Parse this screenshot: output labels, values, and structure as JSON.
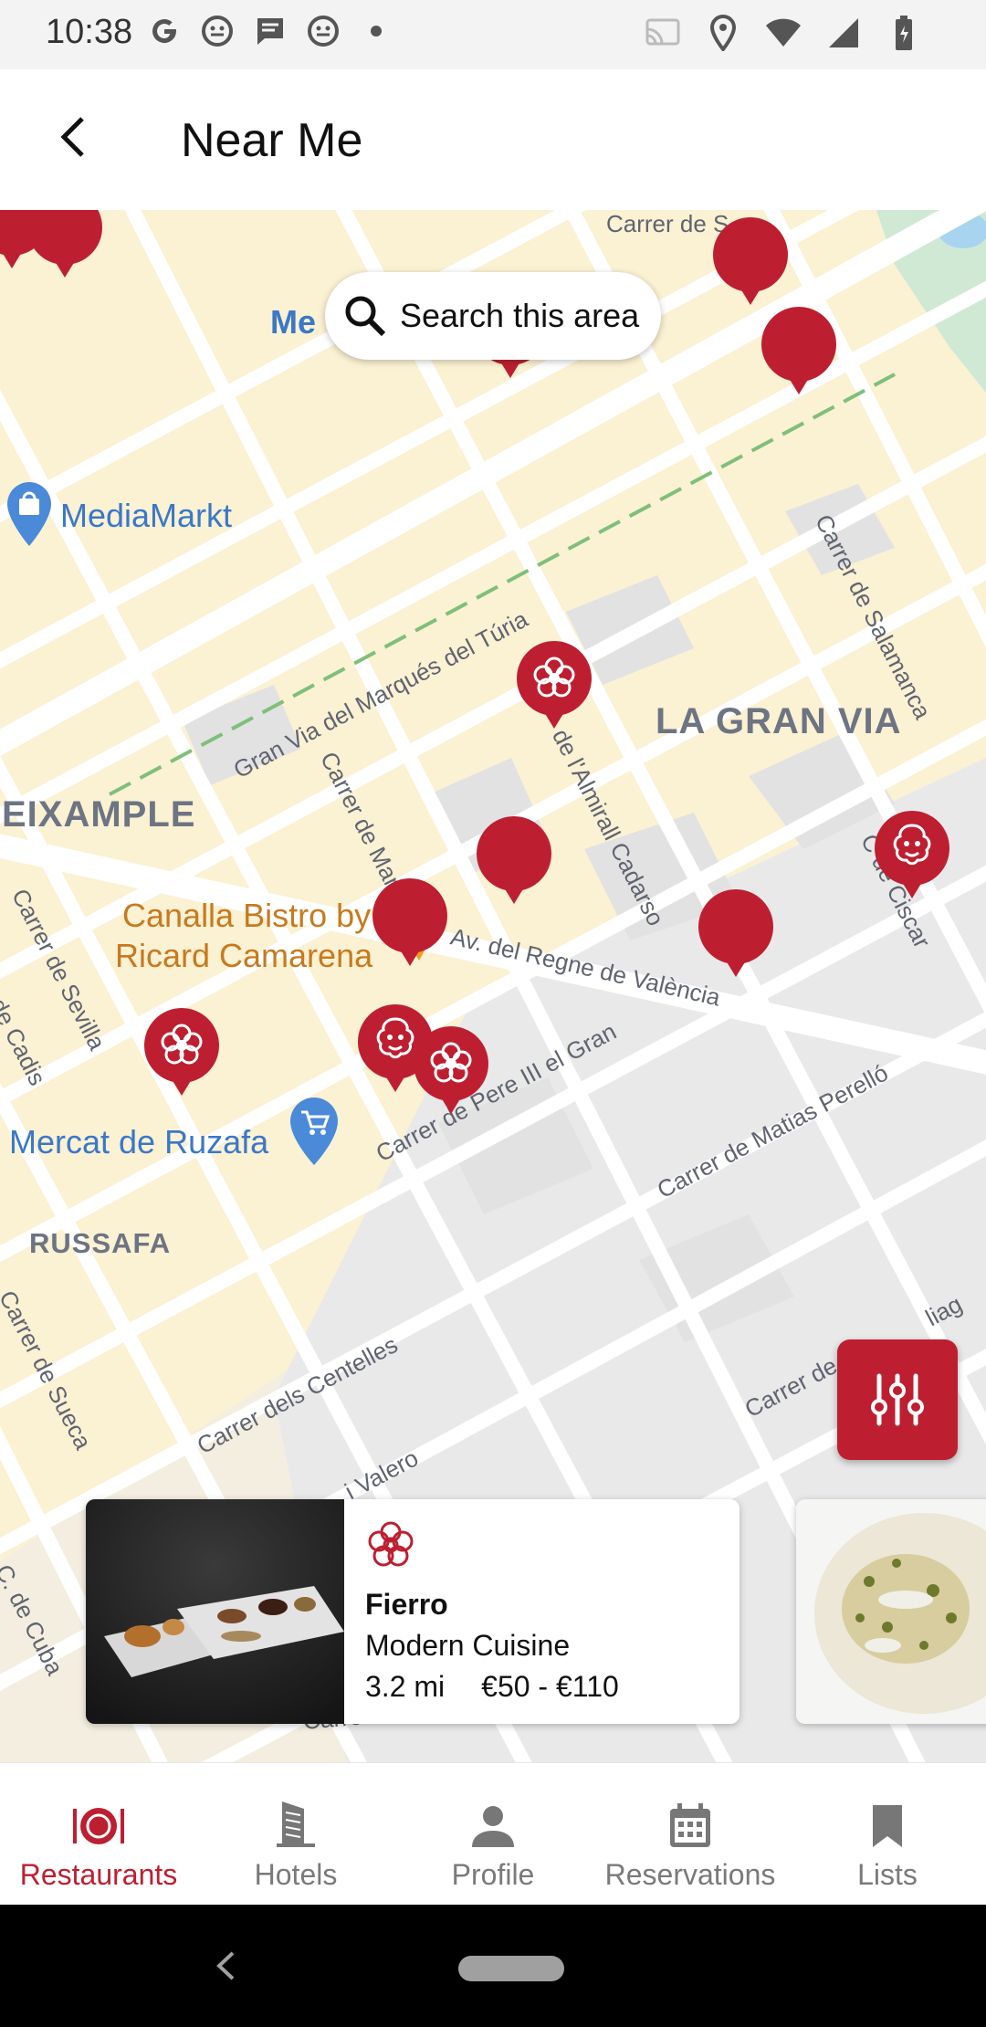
{
  "status_bar": {
    "time": "10:38",
    "left_icons": [
      "google-icon",
      "assistant-face-icon",
      "message-icon",
      "assistant-face-icon",
      "dot-icon"
    ],
    "right_icons": [
      "cast-icon",
      "location-icon",
      "wifi-icon",
      "signal-icon",
      "battery-icon"
    ]
  },
  "app_bar": {
    "title": "Near Me",
    "back_icon": "arrow-back-icon"
  },
  "map": {
    "search_button_label": "Search this area",
    "search_icon": "search-icon",
    "filter_icon": "sliders-icon",
    "labels": {
      "street_salamanca": "Carrer de Salamanca",
      "street_gran_via": "Gran Via del Marqués del Túria",
      "street_almirall": "de l'Almirall Cadarso",
      "street_marti": "Carrer de Mart",
      "street_regne": "Av. del Regne de València",
      "street_pere": "Carrer de Pere III el Gran",
      "street_matias": "Carrer de Matias Perelló",
      "street_centelles": "Carrer dels Centelles",
      "street_valero": "i Valero",
      "street_sueca": "Carrer de Sueca",
      "street_sevilla": "Carrer de Sevilla",
      "street_cadis": "de Cadis",
      "street_ciscar": "C de Ciscar",
      "street_cuba": "C. de Cuba",
      "street_top": "Carrer de S",
      "street_right": "Carrer de",
      "street_diag": "liag",
      "street_bottom": "Carrer de Flandr",
      "district_gran_via": "LA GRAN VIA",
      "district_eixample": "EIXAMPLE",
      "district_russafa": "RUSSAFA",
      "poi_mediamarkt": "MediaMarkt",
      "poi_mercat": "Mercat de Ruzafa",
      "poi_canalla_1": "Canalla Bistro by",
      "poi_canalla_2": "Ricard Camarena",
      "poi_me_partial": "Me"
    }
  },
  "card": {
    "distinction_icon": "michelin-star-icon",
    "name": "Fierro",
    "cuisine": "Modern Cuisine",
    "distance": "3.2 mi",
    "price": "€50 - €110"
  },
  "bottom_nav": [
    {
      "label": "Restaurants",
      "icon": "restaurant-plate-icon",
      "active": true
    },
    {
      "label": "Hotels",
      "icon": "hotel-building-icon",
      "active": false
    },
    {
      "label": "Profile",
      "icon": "person-icon",
      "active": false
    },
    {
      "label": "Reservations",
      "icon": "calendar-icon",
      "active": false
    },
    {
      "label": "Lists",
      "icon": "bookmark-icon",
      "active": false
    }
  ],
  "colors": {
    "brand_red": "#bd1f31",
    "map_block": "#fbf1d3",
    "map_street": "#ffffff",
    "map_gray_block": "#e9e9ea",
    "inactive_nav": "#7a7a7a"
  }
}
